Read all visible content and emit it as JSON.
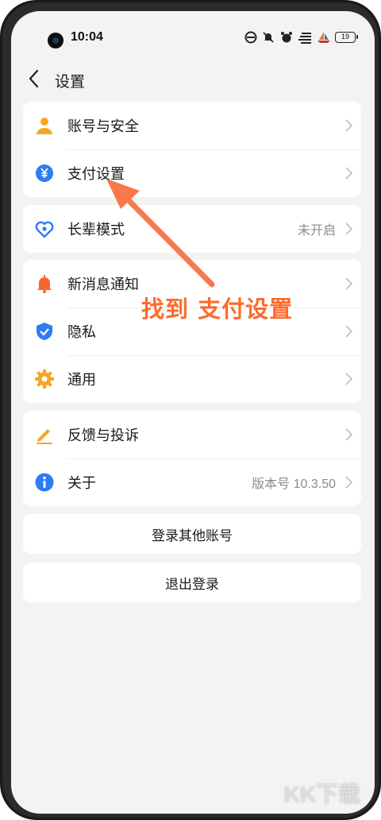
{
  "status_bar": {
    "time": "10:04",
    "battery_level": "19",
    "icons": [
      "wifi-icon",
      "mute-icon",
      "alarm-icon",
      "signal-bars-icon",
      "boat-icon",
      "battery-icon"
    ]
  },
  "header": {
    "title": "设置"
  },
  "groups": [
    {
      "items": [
        {
          "label": "账号与安全",
          "icon": "user-icon",
          "icon_color": "#F5A623"
        },
        {
          "label": "支付设置",
          "icon": "yuan-icon",
          "icon_color": "#2F7BF5"
        }
      ]
    },
    {
      "items": [
        {
          "label": "长辈模式",
          "icon": "elder-heart-icon",
          "icon_color": "#2F7BF5",
          "value": "未开启"
        }
      ]
    },
    {
      "items": [
        {
          "label": "新消息通知",
          "icon": "bell-icon",
          "icon_color": "#F4672A"
        },
        {
          "label": "隐私",
          "icon": "shield-icon",
          "icon_color": "#2F7BF5"
        },
        {
          "label": "通用",
          "icon": "gear-icon",
          "icon_color": "#F5A623"
        }
      ]
    },
    {
      "items": [
        {
          "label": "反馈与投诉",
          "icon": "pen-icon",
          "icon_color": "#F5A623"
        },
        {
          "label": "关于",
          "icon": "info-icon",
          "icon_color": "#2F7BF5",
          "value": "版本号 10.3.50"
        }
      ]
    }
  ],
  "actions": {
    "switch_account": "登录其他账号",
    "logout": "退出登录"
  },
  "annotation": {
    "text": "找到 支付设置",
    "color": "#FF6A2B"
  },
  "watermark": "KK下载"
}
